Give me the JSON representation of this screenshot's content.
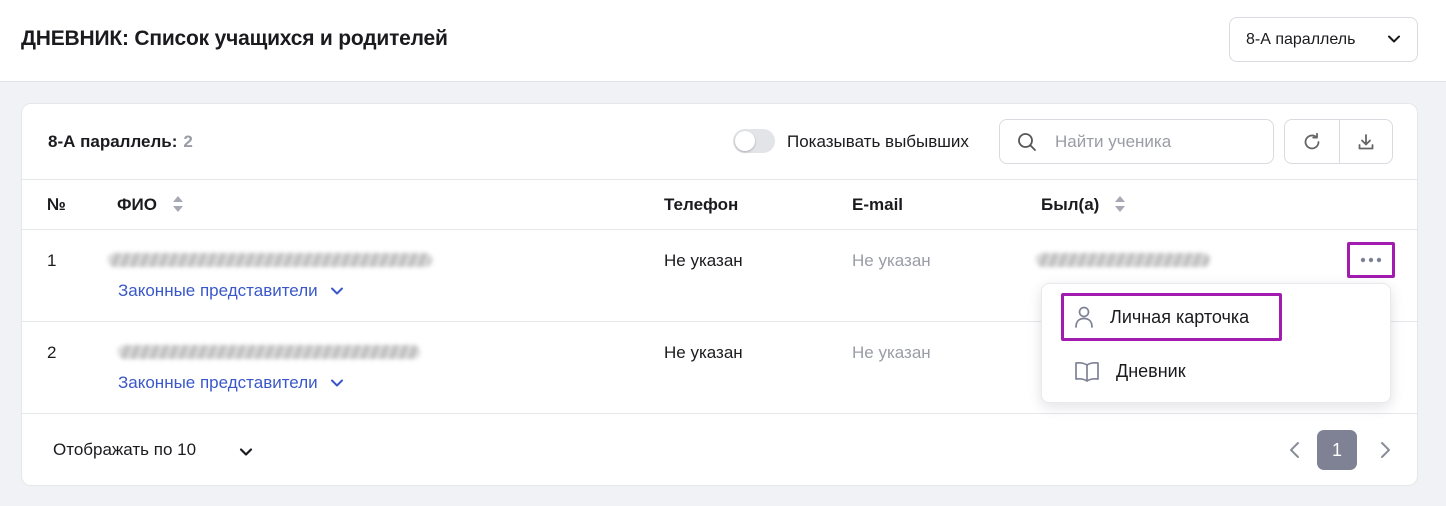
{
  "header": {
    "title": "ДНЕВНИК: Список учащихся и родителей",
    "parallel_select": "8-А параллель"
  },
  "toolbar": {
    "count_label": "8-А параллель:",
    "count_value": "2",
    "toggle_label": "Показывать выбывших",
    "toggle_on": false,
    "search_placeholder": "Найти ученика"
  },
  "table": {
    "columns": [
      "№",
      "ФИО",
      "Телефон",
      "E-mail",
      "Был(а)"
    ],
    "rows": [
      {
        "num": "1",
        "phone": "Не указан",
        "email": "Не указан",
        "guardians": "Законные представители"
      },
      {
        "num": "2",
        "phone": "Не указан",
        "email": "Не указан",
        "guardians": "Законные представители"
      }
    ]
  },
  "menu": {
    "items": [
      "Личная карточка",
      "Дневник"
    ]
  },
  "footer": {
    "per_page": "Отображать по 10",
    "current_page": "1"
  },
  "colors": {
    "accent_link": "#3a58c9",
    "highlight": "#a21caf",
    "active_page": "#7e8294"
  }
}
